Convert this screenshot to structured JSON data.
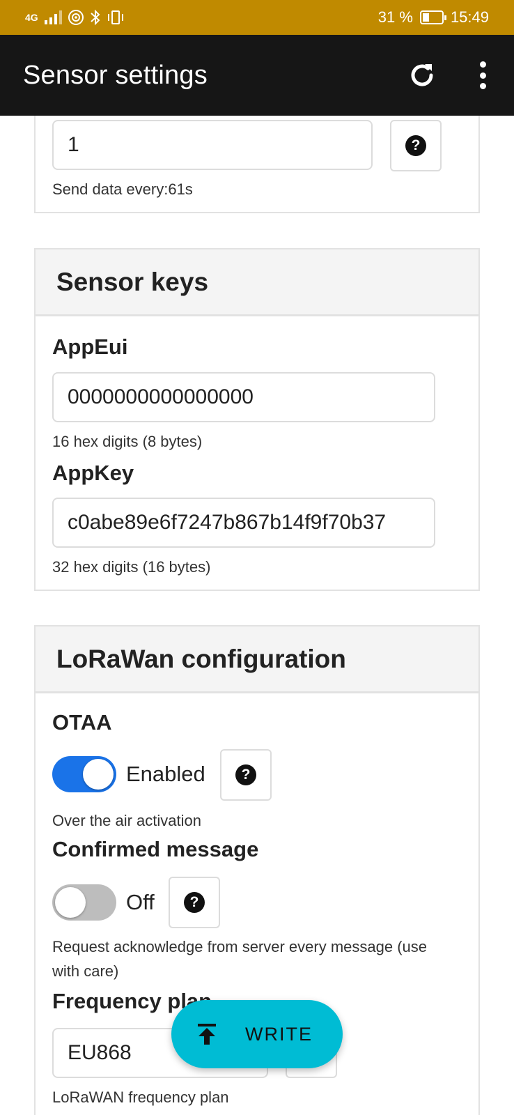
{
  "status_bar": {
    "network": "4G",
    "battery_percent": "31 %",
    "time": "15:49",
    "battery_level": 0.31
  },
  "app_bar": {
    "title": "Sensor settings",
    "refresh_icon": "refresh-icon",
    "more_icon": "more-vert-icon"
  },
  "interval_section": {
    "value": "1",
    "hint": "Send data every:61s"
  },
  "sensor_keys": {
    "title": "Sensor keys",
    "app_eui": {
      "label": "AppEui",
      "value": "0000000000000000",
      "hint": "16 hex digits (8 bytes)"
    },
    "app_key": {
      "label": "AppKey",
      "value": "c0abe89e6f7247b867b14f9f70b37",
      "hint": "32 hex digits (16 bytes)"
    }
  },
  "lorawan": {
    "title": "LoRaWan configuration",
    "otaa": {
      "label": "OTAA",
      "state": "Enabled",
      "enabled": true,
      "hint": "Over the air activation"
    },
    "confirmed": {
      "label": "Confirmed message",
      "state": "Off",
      "enabled": false,
      "hint": "Request acknowledge from server every message (use with care)"
    },
    "frequency": {
      "label": "Frequency plan",
      "selected": "EU868",
      "hint": "LoRaWAN frequency plan"
    }
  },
  "help_symbol": "?",
  "fab": {
    "label": "WRITE",
    "icon": "upload-icon"
  },
  "colors": {
    "status_bar": "#c08a00",
    "app_bar": "#161616",
    "toggle_on": "#1a73e8",
    "fab": "#00bcd4",
    "dropdown_arrow": "#7b4fd6"
  }
}
